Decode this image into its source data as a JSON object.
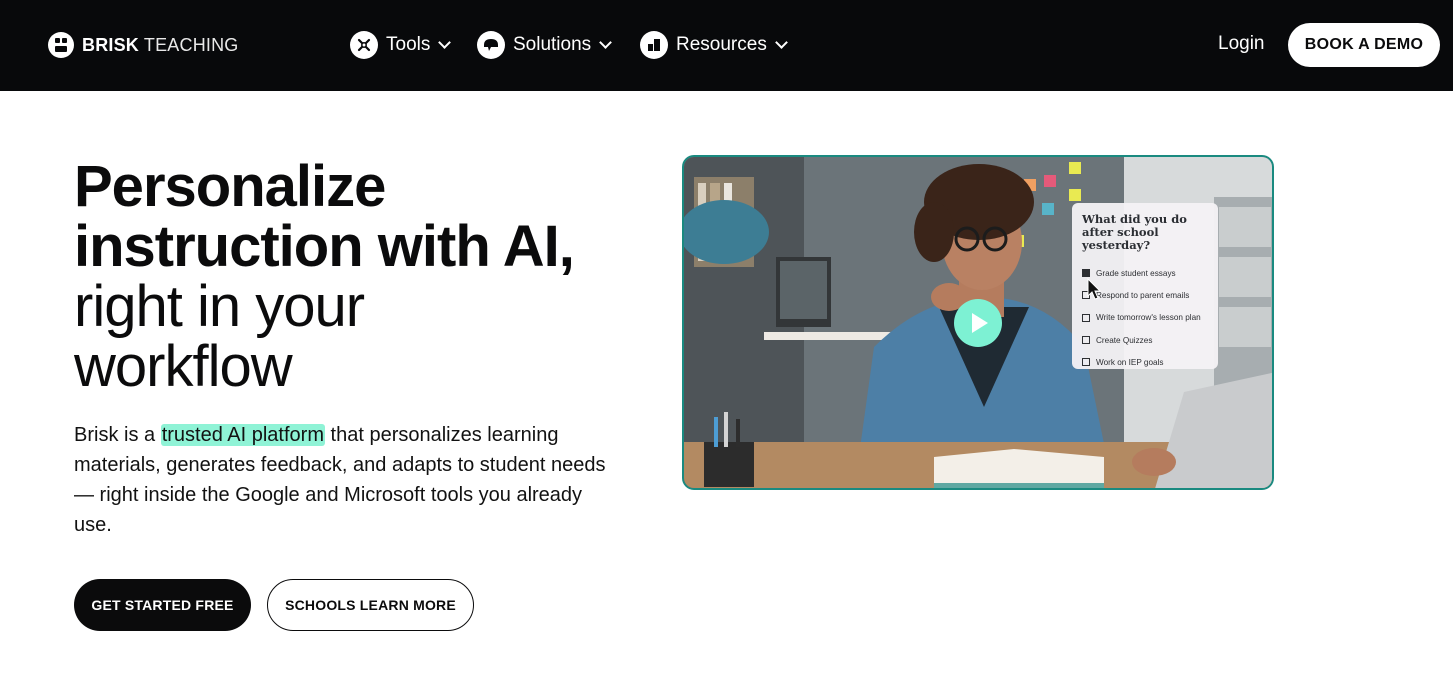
{
  "nav": {
    "brand_bold": "BRISK",
    "brand_light": "TEACHING",
    "menus": [
      {
        "label": "Tools",
        "icon": "tools-icon"
      },
      {
        "label": "Solutions",
        "icon": "solutions-icon"
      },
      {
        "label": "Resources",
        "icon": "resources-icon"
      }
    ],
    "login": "Login",
    "demo": "BOOK A DEMO"
  },
  "hero": {
    "headline_bold_1": "Personalize",
    "headline_bold_2": "instruction with AI,",
    "headline_light_1": "right in your",
    "headline_light_2": "workflow",
    "desc_before": "Brisk is a ",
    "desc_highlight": "trusted AI platform",
    "desc_after": " that personalizes learning materials, generates feedback, and adapts to student needs — right inside the Google and Microsoft tools you already use.",
    "cta_primary": "GET STARTED FREE",
    "cta_secondary": "SCHOOLS LEARN MORE"
  },
  "video": {
    "note_title": "What did you do after school yesterday?",
    "tasks": [
      {
        "label": "Grade student essays",
        "checked": true
      },
      {
        "label": "Respond to parent emails",
        "checked": false
      },
      {
        "label": "Write tomorrow's lesson plan",
        "checked": false
      },
      {
        "label": "Create Quizzes",
        "checked": false
      },
      {
        "label": "Work on IEP goals",
        "checked": false
      }
    ],
    "play_icon": "play-icon"
  },
  "colors": {
    "nav_bg": "#08090b",
    "highlight": "#8ff3d6",
    "play": "#7df1d3",
    "video_border": "#1a8a80"
  }
}
